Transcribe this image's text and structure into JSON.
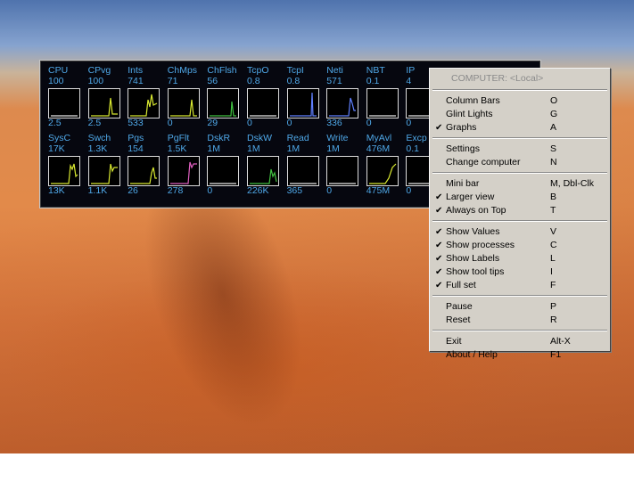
{
  "monitor": {
    "row1": [
      {
        "label": "CPU",
        "value": "100",
        "bottom": "2.5"
      },
      {
        "label": "CPvg",
        "value": "100",
        "bottom": "2.5"
      },
      {
        "label": "Ints",
        "value": "741",
        "bottom": "533"
      },
      {
        "label": "ChMps",
        "value": "71",
        "bottom": "0"
      },
      {
        "label": "ChFlsh",
        "value": "56",
        "bottom": "29"
      },
      {
        "label": "TcpO",
        "value": "0.8",
        "bottom": "0"
      },
      {
        "label": "TcpI",
        "value": "0.8",
        "bottom": "0"
      },
      {
        "label": "Neti",
        "value": "571",
        "bottom": "336"
      },
      {
        "label": "NBT",
        "value": "0.1",
        "bottom": "0"
      },
      {
        "label": "IP",
        "value": "4",
        "bottom": "0"
      }
    ],
    "row2": [
      {
        "label": "SysC",
        "value": "17K",
        "bottom": "13K"
      },
      {
        "label": "Swch",
        "value": "1.3K",
        "bottom": "1.1K"
      },
      {
        "label": "Pgs",
        "value": "154",
        "bottom": "26"
      },
      {
        "label": "PgFlt",
        "value": "1.5K",
        "bottom": "278"
      },
      {
        "label": "DskR",
        "value": "1M",
        "bottom": "0"
      },
      {
        "label": "DskW",
        "value": "1M",
        "bottom": "226K"
      },
      {
        "label": "Read",
        "value": "1M",
        "bottom": "365"
      },
      {
        "label": "Write",
        "value": "1M",
        "bottom": "0"
      },
      {
        "label": "MyAvl",
        "value": "476M",
        "bottom": "475M"
      },
      {
        "label": "Excp",
        "value": "0.1",
        "bottom": "0"
      }
    ]
  },
  "graph_colors": [
    "#e8e8e8",
    "#d8e830",
    "#d8e830",
    "#d8e830",
    "#40c040",
    "#e8e8e8",
    "#6080ff",
    "#6080ff",
    "#e8e8e8",
    "#e8e8e8",
    "#d8e830",
    "#d8e830",
    "#d8e830",
    "#e060c0",
    "#e8e8e8",
    "#40c040",
    "#e8e8e8",
    "#e8e8e8",
    "#d8e830",
    "#e8e8e8"
  ],
  "menu": {
    "header": "COMPUTER: <Local>",
    "groups": [
      [
        {
          "label": "Column Bars",
          "shortcut": "O",
          "checked": false
        },
        {
          "label": "Glint Lights",
          "shortcut": "G",
          "checked": false
        },
        {
          "label": "Graphs",
          "shortcut": "A",
          "checked": true
        }
      ],
      [
        {
          "label": "Settings",
          "shortcut": "S",
          "checked": false
        },
        {
          "label": "Change computer",
          "shortcut": "N",
          "checked": false
        }
      ],
      [
        {
          "label": "Mini bar",
          "shortcut": "M, Dbl-Clk",
          "checked": false
        },
        {
          "label": "Larger view",
          "shortcut": "B",
          "checked": true
        },
        {
          "label": "Always on Top",
          "shortcut": "T",
          "checked": true
        }
      ],
      [
        {
          "label": "Show Values",
          "shortcut": "V",
          "checked": true
        },
        {
          "label": "Show processes",
          "shortcut": "C",
          "checked": true
        },
        {
          "label": "Show Labels",
          "shortcut": "L",
          "checked": true
        },
        {
          "label": "Show tool tips",
          "shortcut": "I",
          "checked": true
        },
        {
          "label": "Full set",
          "shortcut": "F",
          "checked": true
        }
      ],
      [
        {
          "label": "Pause",
          "shortcut": "P",
          "checked": false
        },
        {
          "label": "Reset",
          "shortcut": "R",
          "checked": false
        }
      ],
      [
        {
          "label": "Exit",
          "shortcut": "Alt-X",
          "checked": false
        },
        {
          "label": "About / Help",
          "shortcut": "F1",
          "checked": false
        }
      ]
    ],
    "check_glyph": "✔"
  }
}
